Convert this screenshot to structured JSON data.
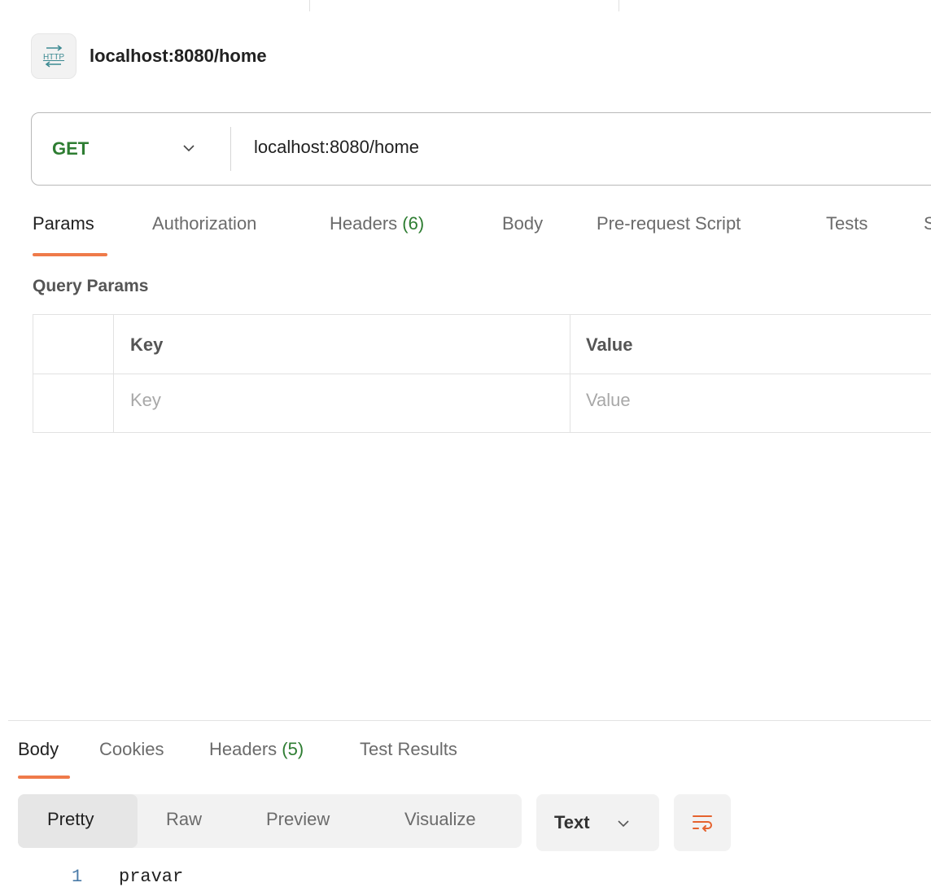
{
  "request": {
    "title": "localhost:8080/home",
    "method": "GET",
    "url": "localhost:8080/home",
    "http_icon_text": "HTTP"
  },
  "request_tabs": [
    {
      "label": "Params",
      "active": true
    },
    {
      "label": "Authorization"
    },
    {
      "label": "Headers",
      "count": "(6)"
    },
    {
      "label": "Body"
    },
    {
      "label": "Pre-request Script"
    },
    {
      "label": "Tests"
    },
    {
      "label": "S"
    }
  ],
  "query_params": {
    "title": "Query Params",
    "header_key": "Key",
    "header_value": "Value",
    "placeholder_key": "Key",
    "placeholder_value": "Value"
  },
  "response_tabs": [
    {
      "label": "Body",
      "active": true
    },
    {
      "label": "Cookies"
    },
    {
      "label": "Headers",
      "count": "(5)"
    },
    {
      "label": "Test Results"
    }
  ],
  "view_modes": [
    "Pretty",
    "Raw",
    "Preview",
    "Visualize"
  ],
  "format": "Text",
  "response_body": {
    "line_number": "1",
    "text": "pravar"
  },
  "colors": {
    "accent": "#ef7a4a",
    "method_get": "#2e7d32",
    "count": "#2e7d32"
  }
}
